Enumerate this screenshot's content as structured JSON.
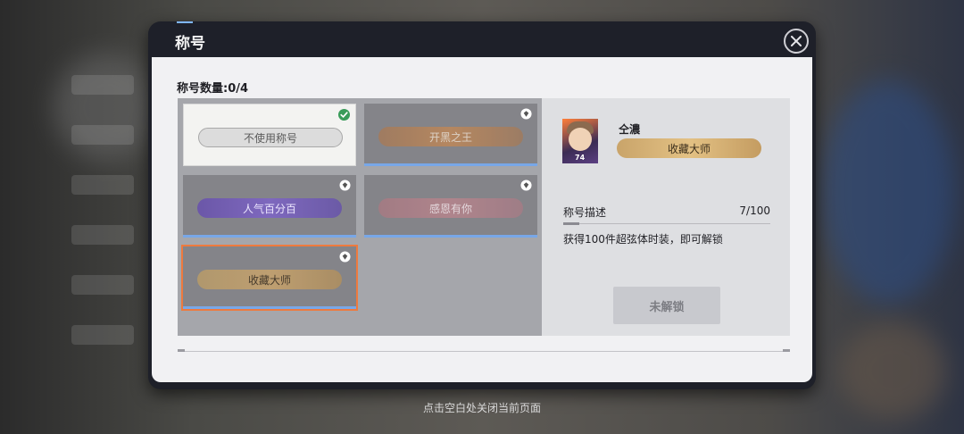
{
  "modal": {
    "title": "称号"
  },
  "count_label": "称号数量:0/4",
  "titles": [
    {
      "label": "不使用称号",
      "state": "selected",
      "icon": "check-circle-icon"
    },
    {
      "label": "开黑之王",
      "state": "locked",
      "icon": "diamond-badge-icon"
    },
    {
      "label": "人气百分百",
      "state": "locked",
      "icon": "diamond-badge-icon"
    },
    {
      "label": "感恩有你",
      "state": "locked",
      "icon": "diamond-badge-icon"
    },
    {
      "label": "收藏大师",
      "state": "active",
      "icon": "diamond-badge-icon"
    }
  ],
  "detail": {
    "player_name": "仝濃",
    "avatar_level": "74",
    "title": "收藏大师",
    "desc_label": "称号描述",
    "desc_count": "7/100",
    "desc_text": "获得100件超弦体时装，即可解锁",
    "button": "未解锁"
  },
  "footer_hint": "点击空白处关闭当前页面",
  "colors": {
    "accent": "#ee7a3e",
    "locked_bar": "#78a7e8",
    "check": "#3a9c5a"
  }
}
